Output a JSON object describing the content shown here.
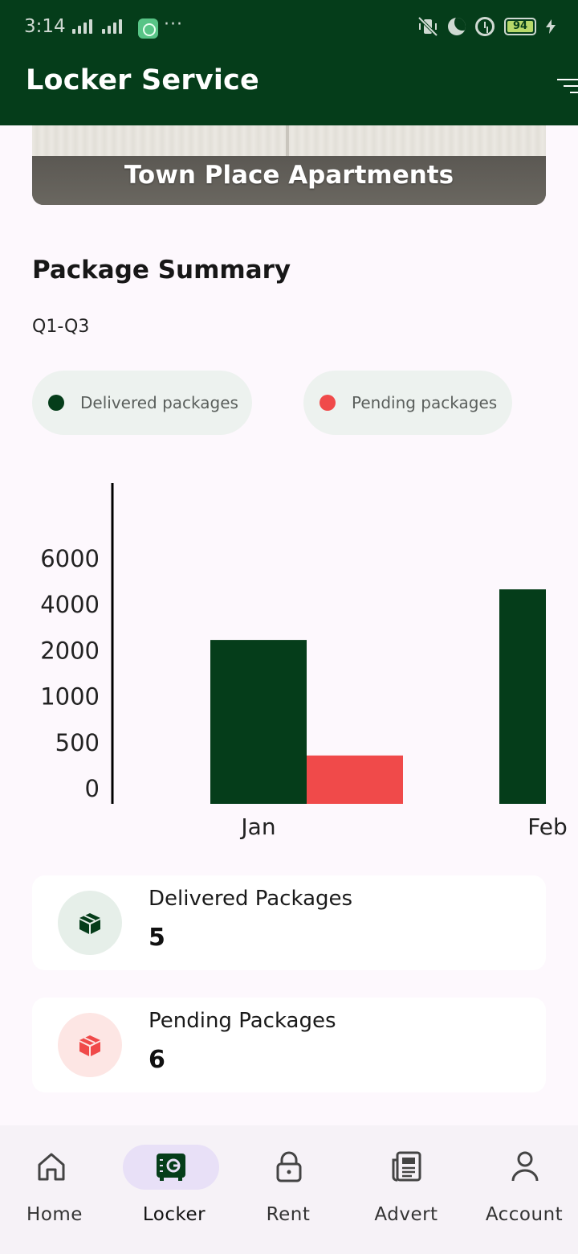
{
  "status_bar": {
    "time": "3:14",
    "battery": "94"
  },
  "app_bar": {
    "title": "Locker Service"
  },
  "banner": {
    "caption": "Town Place Apartments"
  },
  "summary": {
    "title": "Package Summary",
    "period": "Q1-Q3",
    "legend": [
      {
        "label": "Delivered packages",
        "color": "#053d1a"
      },
      {
        "label": "Pending packages",
        "color": "#f04a4a"
      }
    ]
  },
  "chart_data": {
    "type": "bar",
    "categories": [
      "Jan",
      "Feb"
    ],
    "y_tick_labels": [
      "0",
      "500",
      "1000",
      "2000",
      "4000",
      "6000"
    ],
    "series": [
      {
        "name": "Delivered packages",
        "color": "#053d1a",
        "values": [
          2500,
          4700
        ]
      },
      {
        "name": "Pending packages",
        "color": "#f04a4a",
        "values": [
          400,
          null
        ]
      }
    ],
    "axis_scale": "category-ticks",
    "grid": false
  },
  "cards": {
    "delivered": {
      "title": "Delivered Packages",
      "value": "5"
    },
    "pending": {
      "title": "Pending Packages",
      "value": "6"
    }
  },
  "bottom_nav": {
    "items": [
      {
        "label": "Home",
        "icon": "home-icon"
      },
      {
        "label": "Locker",
        "icon": "locker-icon"
      },
      {
        "label": "Rent",
        "icon": "lock-icon"
      },
      {
        "label": "Advert",
        "icon": "newspaper-icon"
      },
      {
        "label": "Account",
        "icon": "person-icon"
      }
    ],
    "active": "Locker"
  }
}
